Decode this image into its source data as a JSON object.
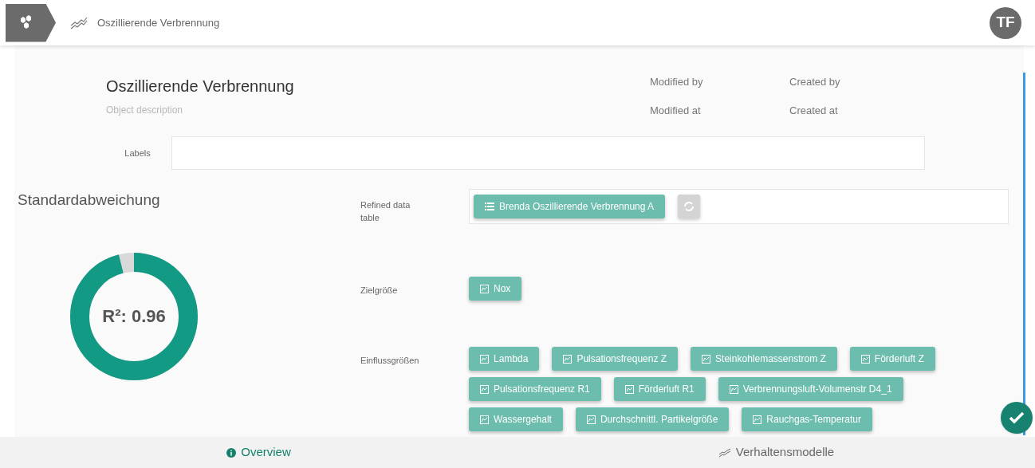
{
  "header": {
    "breadcrumb": "Oszillierende Verbrennung",
    "avatar": "TF"
  },
  "object": {
    "title": "Oszillierende Verbrennung",
    "description_placeholder": "Object description",
    "meta": [
      "Modified by",
      "Created by",
      "Modified at",
      "Created at"
    ],
    "labels_label": "Labels"
  },
  "score": {
    "title": "Standardabweichung",
    "reading": "R²: 0.96",
    "level": 0.96
  },
  "fields": [
    {
      "label": "Refined data table",
      "kind": "table",
      "chips": [
        "Brenda Oszillierende Verbrennung A"
      ]
    },
    {
      "label": "Zielgröße",
      "kind": "variables",
      "chips": [
        "Nox"
      ]
    },
    {
      "label": "Einflussgrößen",
      "kind": "variables",
      "chips": [
        "Lambda",
        "Pulsationsfrequenz Z",
        "Steinkohlemassenstrom Z",
        "Förderluft Z",
        "Pulsationsfrequenz R1",
        "Förderluft R1",
        "Verbrennungsluft-Volumenstr D4_1",
        "Wassergehalt",
        "Durchschnittl. Partikelgröße",
        "Rauchgas-Temperatur"
      ]
    }
  ],
  "tabs": [
    {
      "label": "Overview",
      "kind": "info",
      "selected": true
    },
    {
      "label": "Verhaltensmodelle",
      "kind": "chart",
      "selected": false
    }
  ]
}
